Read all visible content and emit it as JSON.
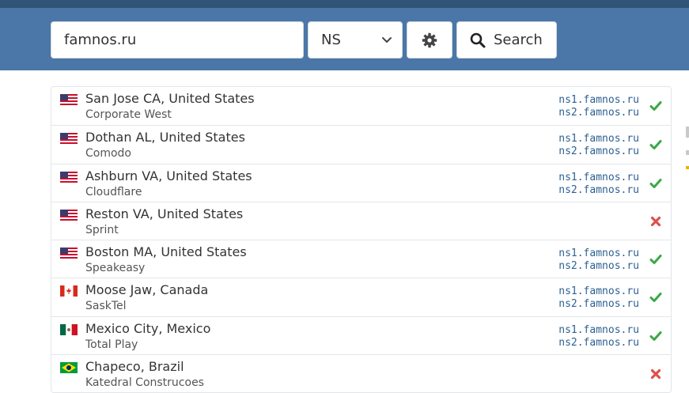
{
  "search": {
    "value": "famnos.ru"
  },
  "record_type": {
    "selected": "NS"
  },
  "buttons": {
    "search_label": "Search"
  },
  "icons": {
    "settings": "gear-icon",
    "search": "magnifier-icon",
    "select": "chevron-down-icon",
    "ok": "check-icon",
    "fail": "cross-icon"
  },
  "colors": {
    "header": "#4a77a8",
    "header_top": "#2f5478",
    "ok": "#3aa845",
    "fail": "#d9534f",
    "ns_text": "#2d6093"
  },
  "results": [
    {
      "flag": "US",
      "location": "San Jose CA, United States",
      "provider": "Corporate West",
      "ns1": "ns1.famnos.ru",
      "ns2": "ns2.famnos.ru",
      "status": "ok"
    },
    {
      "flag": "US",
      "location": "Dothan AL, United States",
      "provider": "Comodo",
      "ns1": "ns1.famnos.ru",
      "ns2": "ns2.famnos.ru",
      "status": "ok"
    },
    {
      "flag": "US",
      "location": "Ashburn VA, United States",
      "provider": "Cloudflare",
      "ns1": "ns1.famnos.ru",
      "ns2": "ns2.famnos.ru",
      "status": "ok"
    },
    {
      "flag": "US",
      "location": "Reston VA, United States",
      "provider": "Sprint",
      "ns1": "",
      "ns2": "",
      "status": "fail"
    },
    {
      "flag": "US",
      "location": "Boston MA, United States",
      "provider": "Speakeasy",
      "ns1": "ns1.famnos.ru",
      "ns2": "ns2.famnos.ru",
      "status": "ok"
    },
    {
      "flag": "CA",
      "location": "Moose Jaw, Canada",
      "provider": "SaskTel",
      "ns1": "ns1.famnos.ru",
      "ns2": "ns2.famnos.ru",
      "status": "ok"
    },
    {
      "flag": "MX",
      "location": "Mexico City, Mexico",
      "provider": "Total Play",
      "ns1": "ns1.famnos.ru",
      "ns2": "ns2.famnos.ru",
      "status": "ok"
    },
    {
      "flag": "BR",
      "location": "Chapeco, Brazil",
      "provider": "Katedral Construcoes",
      "ns1": "",
      "ns2": "",
      "status": "fail"
    }
  ]
}
